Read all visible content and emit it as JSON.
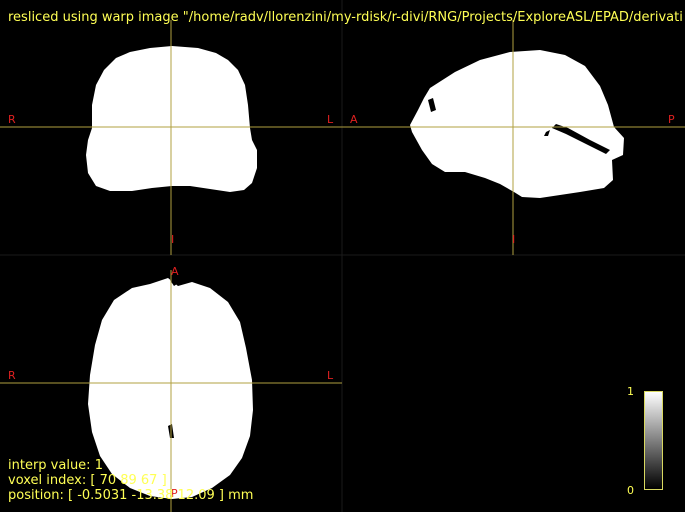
{
  "header": {
    "title": "resliced using warp image \"/home/radv/llorenzini/my-rdisk/r-divi/RNG/Projects/ExploreASL/EPAD/derivati"
  },
  "orientation_labels": {
    "coronal": {
      "left": "R",
      "right": "L",
      "bottom": "I"
    },
    "sagittal": {
      "left": "A",
      "right": "P",
      "bottom": "I"
    },
    "axial": {
      "left": "R",
      "right": "L",
      "top": "A",
      "bottom": "P"
    }
  },
  "info": {
    "interp_value": "interp value: 1",
    "voxel_index": "voxel index: [ 70 89 67 ]",
    "position": "position: [ -0.5031 -13.38 12.09 ] mm"
  },
  "colorbar": {
    "max": "1",
    "min": "0"
  },
  "colors": {
    "text": "#ffff55",
    "orientation": "#e02020",
    "crosshair": "#b0a040",
    "mask": "#ffffff",
    "background": "#000000"
  }
}
